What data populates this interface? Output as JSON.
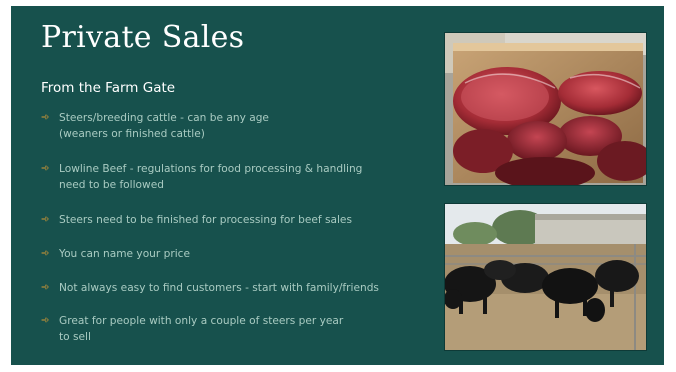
{
  "slide": {
    "title": "Private Sales",
    "subtitle": "From the Farm Gate",
    "accent_color": "#d99a32",
    "background_color": "#17514d",
    "bullet_icon": "arrow-right-icon",
    "bullets": [
      "Steers/breeding cattle - can be any age\n(weaners or finished cattle)",
      "Lowline Beef - regulations for food processing & handling\nneed to be followed",
      "Steers need to be finished for processing for beef sales",
      "You can name your price",
      "Not always easy to find customers - start with family/friends",
      "Great for people with only a couple of steers per year\nto sell"
    ]
  }
}
